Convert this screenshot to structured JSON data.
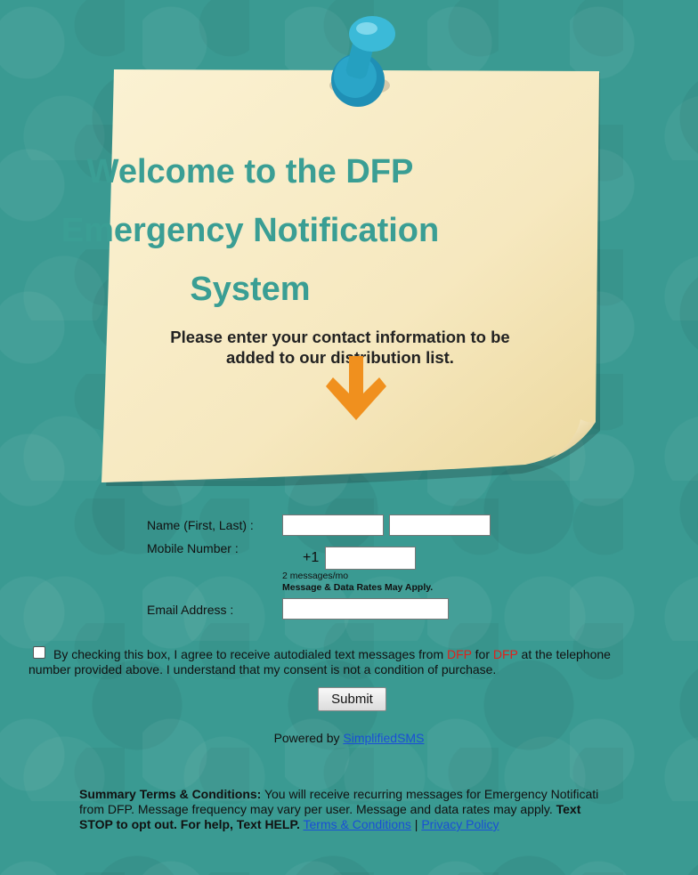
{
  "note": {
    "title_line1": "Welcome to the DFP",
    "title_line2": "Emergency Notification",
    "title_line3": "System",
    "subtitle_line1": "Please enter your contact information to be",
    "subtitle_line2": "added to our distribution list."
  },
  "form": {
    "name_label": "Name (First, Last) :",
    "first_name_value": "",
    "last_name_value": "",
    "mobile_label": "Mobile Number :",
    "country_code": "+1",
    "mobile_value": "",
    "frequency_note": "2 messages/mo",
    "rates_note": "Message & Data Rates May Apply.",
    "email_label": "Email Address :",
    "email_value": "",
    "consent_part1": "By checking this box, I agree to receive autodialed text messages from ",
    "consent_brand1": "DFP",
    "consent_part2": " for ",
    "consent_brand2": "DFP",
    "consent_part3": " at the telephone number provided above. I understand that my consent is not a condition of purchase.",
    "submit_label": "Submit"
  },
  "footer": {
    "powered_by": "Powered by ",
    "powered_link": "SimplifiedSMS",
    "terms_heading": "Summary Terms & Conditions:",
    "terms_body": " You will receive recurring messages for Emergency Notificati from DFP. Message frequency may vary per user. Message and data rates may apply. ",
    "terms_stop": "Text STOP to opt out. For help, Text HELP.",
    "terms_link": "Terms & Conditions",
    "separator": " | ",
    "privacy_link": "Privacy Policy"
  },
  "colors": {
    "background": "#3a9a92",
    "title": "#3a9e94",
    "arrow": "#f0901e",
    "pin": "#2aa5c8",
    "brand_red": "#e0201a",
    "link": "#1a4fd6"
  }
}
